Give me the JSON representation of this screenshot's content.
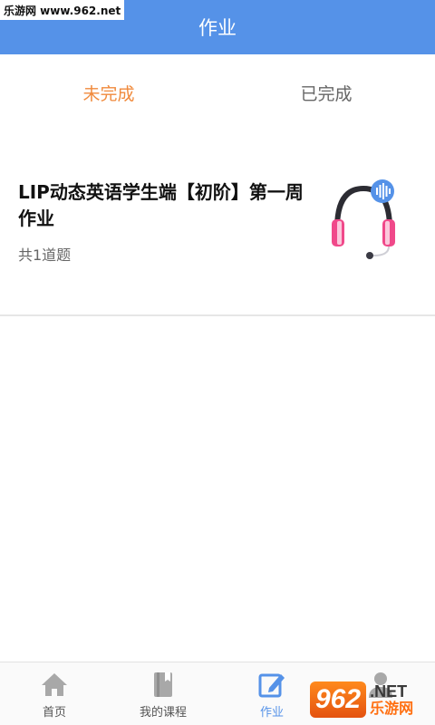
{
  "watermark": {
    "site_top": "乐游网 www.962.net",
    "logo": "962",
    "logo_net": ".NET",
    "logo_cn": "乐游网"
  },
  "header": {
    "title": "作业"
  },
  "tabs": [
    {
      "label": "未完成",
      "active": true
    },
    {
      "label": "已完成",
      "active": false
    }
  ],
  "homework": [
    {
      "title": "LIP动态英语学生端【初阶】第一周作业",
      "count": "共1道题",
      "icon": "headphones-icon"
    }
  ],
  "tabbar": {
    "items": [
      {
        "label": "首页",
        "icon": "home-icon",
        "active": false
      },
      {
        "label": "我的课程",
        "icon": "book-icon",
        "active": false
      },
      {
        "label": "作业",
        "icon": "edit-icon",
        "active": true
      },
      {
        "label": "",
        "icon": "profile-icon",
        "active": false
      }
    ]
  },
  "colors": {
    "primary": "#5592e8",
    "tab_active": "#f08a3c",
    "headphone_pink": "#f0498a"
  }
}
